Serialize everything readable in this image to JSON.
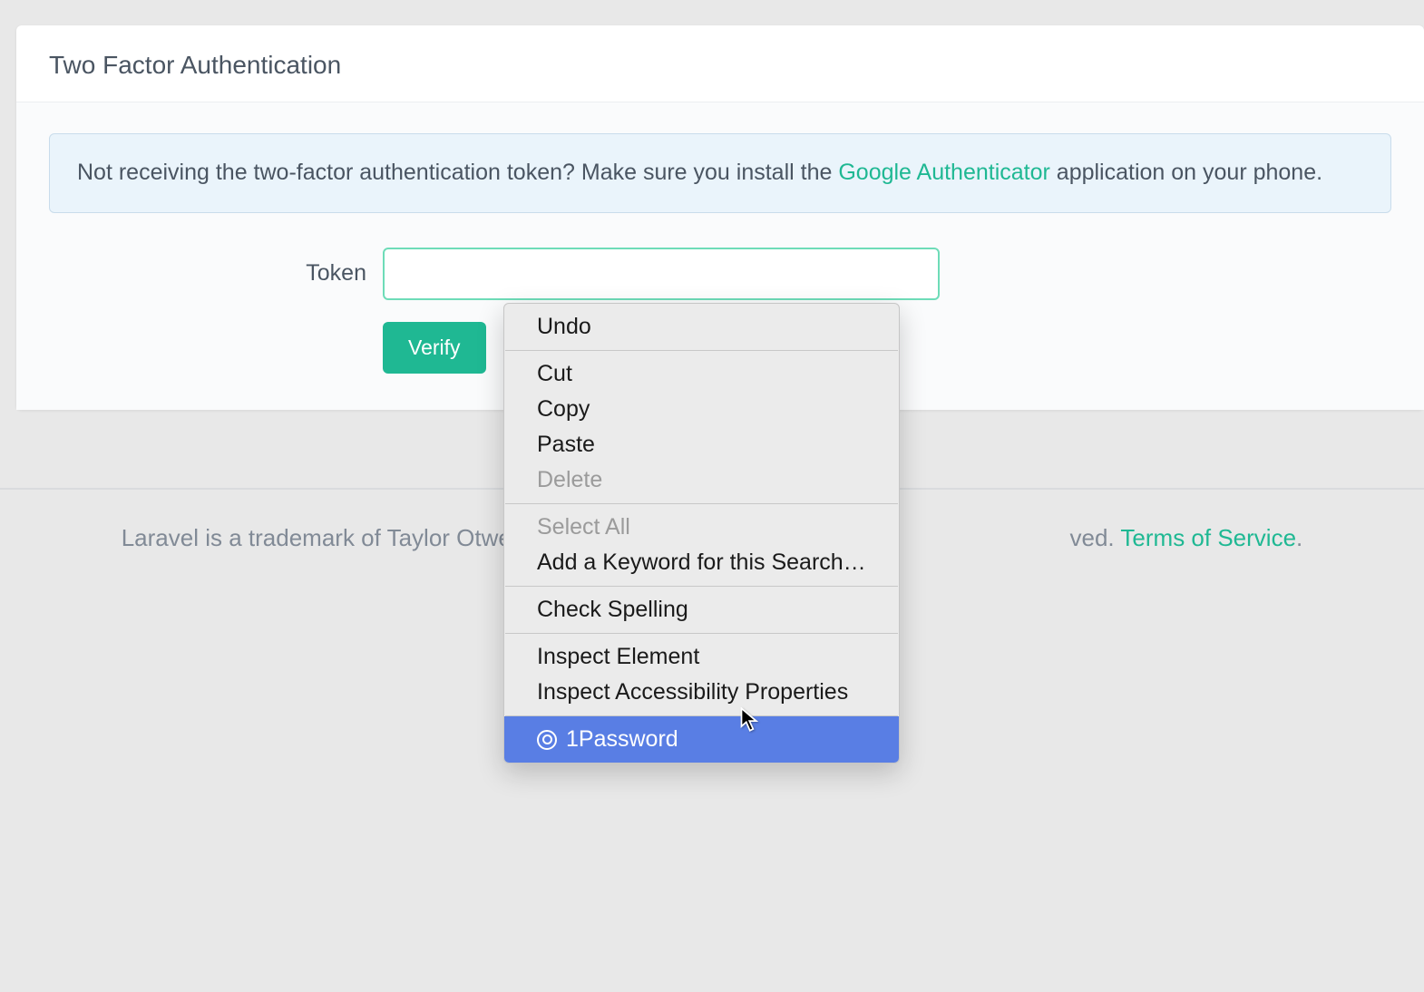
{
  "card": {
    "title": "Two Factor Authentication",
    "alert_before": "Not receiving the two-factor authentication token? Make sure you install the ",
    "alert_link": "Google Authenticator",
    "alert_after": " application on your phone.",
    "token_label": "Token",
    "token_value": "",
    "verify_label": "Verify"
  },
  "footer": {
    "text_before": "Laravel is a trademark of Taylor Otwell",
    "text_after": "ved. ",
    "terms_label": "Terms of Service",
    "trailing": "."
  },
  "context_menu": {
    "items": [
      {
        "label": "Undo",
        "disabled": false,
        "pos": "only"
      },
      {
        "sep": true
      },
      {
        "label": "Cut",
        "disabled": false,
        "pos": "first"
      },
      {
        "label": "Copy",
        "disabled": false,
        "pos": "mid"
      },
      {
        "label": "Paste",
        "disabled": false,
        "pos": "mid"
      },
      {
        "label": "Delete",
        "disabled": true,
        "pos": "last"
      },
      {
        "sep": true
      },
      {
        "label": "Select All",
        "disabled": true,
        "pos": "first"
      },
      {
        "label": "Add a Keyword for this Search…",
        "disabled": false,
        "pos": "last"
      },
      {
        "sep": true
      },
      {
        "label": "Check Spelling",
        "disabled": false,
        "pos": "only"
      },
      {
        "sep": true
      },
      {
        "label": "Inspect Element",
        "disabled": false,
        "pos": "first"
      },
      {
        "label": "Inspect Accessibility Properties",
        "disabled": false,
        "pos": "last"
      },
      {
        "sep": true
      },
      {
        "label": "1Password",
        "disabled": false,
        "highlighted": true,
        "icon": "onepassword",
        "pos": "only"
      }
    ]
  }
}
